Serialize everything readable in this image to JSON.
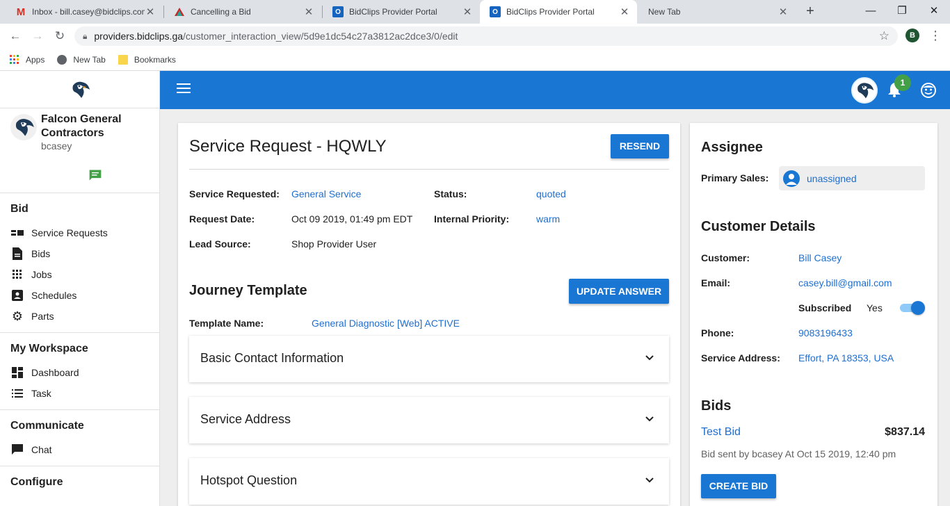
{
  "browser": {
    "tabs": [
      {
        "title": "Inbox - bill.casey@bidclips.com",
        "favicon": "gmail-icon"
      },
      {
        "title": "Cancelling a Bid",
        "favicon": "mountain-icon"
      },
      {
        "title": "BidClips Provider Portal",
        "favicon": "bidclips-icon"
      },
      {
        "title": "BidClips Provider Portal",
        "favicon": "bidclips-icon",
        "active": true
      },
      {
        "title": "New Tab",
        "favicon": ""
      }
    ],
    "url_host": "providers.bidclips.ga",
    "url_path": "/customer_interaction_view/5d9e1dc54c27a3812ac2dce3/0/edit",
    "profile_initial": "B",
    "bookmarks": [
      "Apps",
      "New Tab",
      "Bookmarks"
    ]
  },
  "sidebar": {
    "company_name": "Falcon General Contractors",
    "username": "bcasey",
    "sections": [
      {
        "heading": "Bid",
        "items": [
          "Service Requests",
          "Bids",
          "Jobs",
          "Schedules",
          "Parts"
        ]
      },
      {
        "heading": "My Workspace",
        "items": [
          "Dashboard",
          "Task"
        ]
      },
      {
        "heading": "Communicate",
        "items": [
          "Chat"
        ]
      },
      {
        "heading": "Configure",
        "items": []
      }
    ]
  },
  "appbar": {
    "notification_count": "1",
    "accent": "#1976d2"
  },
  "request": {
    "title": "Service Request - HQWLY",
    "resend_label": "RESEND",
    "fields": {
      "service_requested_label": "Service Requested:",
      "service_requested": "General Service",
      "status_label": "Status:",
      "status": "quoted",
      "request_date_label": "Request Date:",
      "request_date": "Oct 09 2019, 01:49 pm EDT",
      "priority_label": "Internal Priority:",
      "priority": "warm",
      "lead_source_label": "Lead Source:",
      "lead_source": "Shop Provider User"
    },
    "journey_title": "Journey Template",
    "update_label": "UPDATE ANSWER",
    "template_label": "Template Name:",
    "template_name": "General Diagnostic [Web] ACTIVE",
    "accordions": [
      "Basic Contact Information",
      "Service Address",
      "Hotspot Question"
    ]
  },
  "assignee": {
    "title": "Assignee",
    "primary_sales_label": "Primary Sales:",
    "primary_sales": "unassigned"
  },
  "customer": {
    "title": "Customer Details",
    "customer_label": "Customer:",
    "customer": "Bill Casey",
    "email_label": "Email:",
    "email": "casey.bill@gmail.com",
    "subscribed_label": "Subscribed",
    "subscribed_value": "Yes",
    "phone_label": "Phone:",
    "phone": "9083196433",
    "address_label": "Service Address:",
    "address": "Effort, PA 18353, USA"
  },
  "bids": {
    "title": "Bids",
    "bid_name": "Test Bid",
    "bid_amount": "$837.14",
    "bid_sent": "Bid sent by bcasey At Oct 15 2019, 12:40 pm",
    "create_label": "CREATE BID"
  }
}
